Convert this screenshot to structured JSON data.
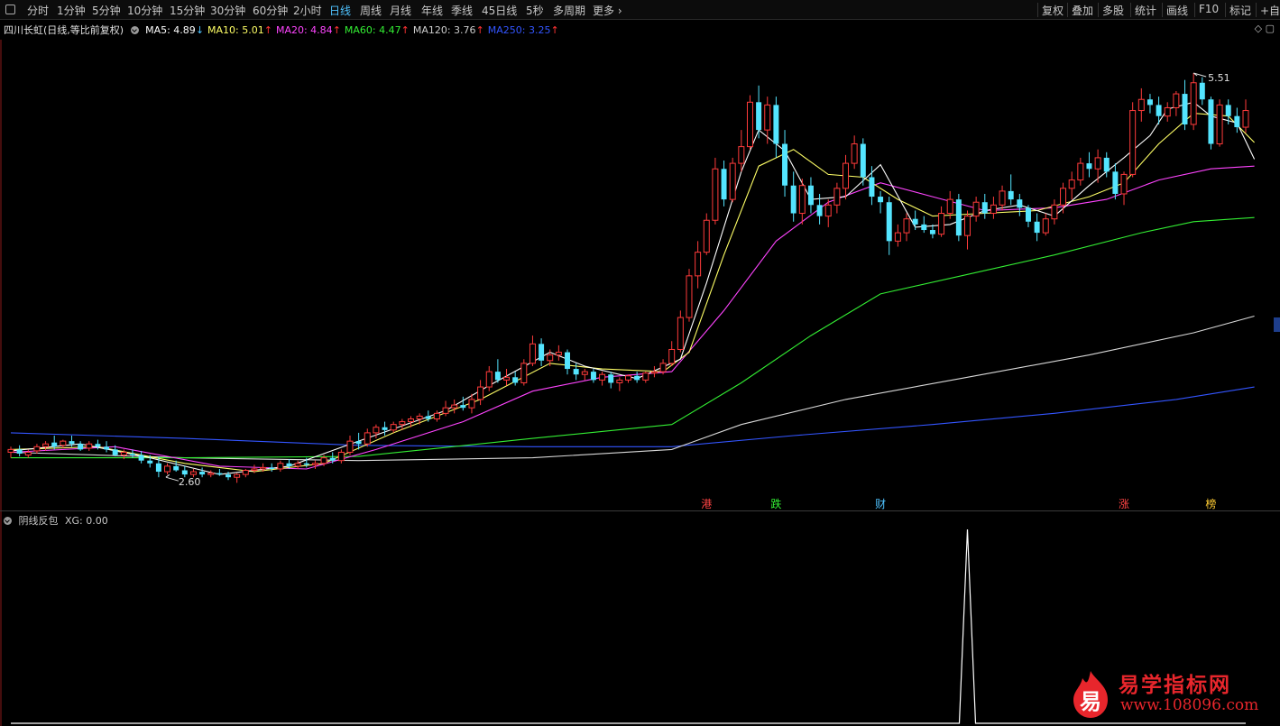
{
  "toolbar": {
    "tabs": [
      "分时",
      "1分钟",
      "5分钟",
      "10分钟",
      "15分钟",
      "30分钟",
      "60分钟",
      "2小时",
      "日线",
      "周线",
      "月线",
      "年线",
      "季线",
      "45日线",
      "5秒",
      "多周期",
      "更多"
    ],
    "active_tab": "日线",
    "right_buttons": [
      "复权",
      "叠加",
      "多股",
      "统计",
      "画线",
      "F10",
      "标记",
      "+自选"
    ]
  },
  "legend": {
    "title": "四川长虹(日线,等比前复权)",
    "ma": [
      {
        "label": "MA5: 4.89",
        "arrow": "↓",
        "color": "#ffffff",
        "arrow_color": "#4fc3ff"
      },
      {
        "label": "MA10: 5.01",
        "arrow": "↑",
        "color": "#ffff66",
        "arrow_color": "#ff3333"
      },
      {
        "label": "MA20: 4.84",
        "arrow": "↑",
        "color": "#ff44ff",
        "arrow_color": "#ff3333"
      },
      {
        "label": "MA60: 4.47",
        "arrow": "↑",
        "color": "#33ee33",
        "arrow_color": "#ff3333"
      },
      {
        "label": "MA120: 3.76",
        "arrow": "↑",
        "color": "#cccccc",
        "arrow_color": "#ff3333"
      },
      {
        "label": "MA250: 3.25",
        "arrow": "↑",
        "color": "#3355ff",
        "arrow_color": "#ff3333"
      }
    ]
  },
  "indicator": {
    "name": "阴线反包",
    "value_label": "XG: 0.00"
  },
  "chart_data": {
    "type": "candlestick",
    "price_range": [
      2.4,
      5.75
    ],
    "high_label": "5.51",
    "low_label": "2.60",
    "colors": {
      "up": "#ff3b3b",
      "down": "#54e5ff",
      "ma5": "#ffffff",
      "ma10": "#ffff66",
      "ma20": "#ff44ff",
      "ma60": "#33ee33",
      "ma120": "#d8d8d8",
      "ma250": "#3355ff"
    },
    "markers": [
      {
        "text": "港",
        "index": 80,
        "color": "#ff4444"
      },
      {
        "text": "跌",
        "index": 88,
        "color": "#33ee33"
      },
      {
        "text": "财",
        "index": 100,
        "color": "#4fc3ff"
      },
      {
        "text": "涨",
        "index": 128,
        "color": "#ff4444"
      },
      {
        "text": "榜",
        "index": 138,
        "color": "#ffcc33"
      }
    ],
    "xg_signal_index": 110,
    "ohlc": [
      [
        2.78,
        2.82,
        2.74,
        2.8
      ],
      [
        2.8,
        2.83,
        2.75,
        2.77
      ],
      [
        2.76,
        2.8,
        2.74,
        2.78
      ],
      [
        2.79,
        2.84,
        2.77,
        2.82
      ],
      [
        2.82,
        2.86,
        2.79,
        2.84
      ],
      [
        2.85,
        2.9,
        2.8,
        2.82
      ],
      [
        2.83,
        2.87,
        2.81,
        2.86
      ],
      [
        2.86,
        2.9,
        2.82,
        2.84
      ],
      [
        2.84,
        2.86,
        2.79,
        2.8
      ],
      [
        2.81,
        2.86,
        2.79,
        2.84
      ],
      [
        2.84,
        2.87,
        2.8,
        2.82
      ],
      [
        2.82,
        2.86,
        2.78,
        2.8
      ],
      [
        2.8,
        2.83,
        2.75,
        2.76
      ],
      [
        2.76,
        2.8,
        2.73,
        2.78
      ],
      [
        2.77,
        2.8,
        2.74,
        2.76
      ],
      [
        2.76,
        2.79,
        2.7,
        2.72
      ],
      [
        2.72,
        2.76,
        2.67,
        2.7
      ],
      [
        2.7,
        2.75,
        2.6,
        2.64
      ],
      [
        2.64,
        2.7,
        2.62,
        2.68
      ],
      [
        2.68,
        2.72,
        2.64,
        2.65
      ],
      [
        2.65,
        2.68,
        2.6,
        2.62
      ],
      [
        2.62,
        2.66,
        2.6,
        2.64
      ],
      [
        2.64,
        2.67,
        2.6,
        2.62
      ],
      [
        2.62,
        2.65,
        2.6,
        2.63
      ],
      [
        2.63,
        2.66,
        2.61,
        2.62
      ],
      [
        2.62,
        2.64,
        2.58,
        2.6
      ],
      [
        2.6,
        2.63,
        2.56,
        2.62
      ],
      [
        2.62,
        2.66,
        2.6,
        2.65
      ],
      [
        2.65,
        2.69,
        2.63,
        2.66
      ],
      [
        2.66,
        2.7,
        2.64,
        2.67
      ],
      [
        2.67,
        2.7,
        2.64,
        2.66
      ],
      [
        2.66,
        2.72,
        2.64,
        2.7
      ],
      [
        2.7,
        2.73,
        2.66,
        2.68
      ],
      [
        2.68,
        2.72,
        2.66,
        2.7
      ],
      [
        2.7,
        2.74,
        2.67,
        2.69
      ],
      [
        2.69,
        2.72,
        2.66,
        2.7
      ],
      [
        2.7,
        2.76,
        2.68,
        2.74
      ],
      [
        2.74,
        2.78,
        2.7,
        2.72
      ],
      [
        2.72,
        2.8,
        2.7,
        2.78
      ],
      [
        2.78,
        2.9,
        2.76,
        2.86
      ],
      [
        2.86,
        2.92,
        2.8,
        2.84
      ],
      [
        2.84,
        2.95,
        2.82,
        2.92
      ],
      [
        2.92,
        2.98,
        2.88,
        2.96
      ],
      [
        2.96,
        3.0,
        2.9,
        2.94
      ],
      [
        2.94,
        3.0,
        2.92,
        2.98
      ],
      [
        2.98,
        3.02,
        2.94,
        3.0
      ],
      [
        3.0,
        3.04,
        2.96,
        3.02
      ],
      [
        3.02,
        3.06,
        2.98,
        3.04
      ],
      [
        3.04,
        3.08,
        3.0,
        3.02
      ],
      [
        3.02,
        3.08,
        3.0,
        3.06
      ],
      [
        3.06,
        3.15,
        3.04,
        3.1
      ],
      [
        3.1,
        3.16,
        3.06,
        3.12
      ],
      [
        3.12,
        3.18,
        3.08,
        3.1
      ],
      [
        3.1,
        3.2,
        3.06,
        3.16
      ],
      [
        3.16,
        3.3,
        3.12,
        3.25
      ],
      [
        3.25,
        3.4,
        3.22,
        3.36
      ],
      [
        3.36,
        3.45,
        3.28,
        3.3
      ],
      [
        3.3,
        3.38,
        3.26,
        3.32
      ],
      [
        3.32,
        3.36,
        3.26,
        3.28
      ],
      [
        3.28,
        3.45,
        3.26,
        3.42
      ],
      [
        3.42,
        3.62,
        3.4,
        3.56
      ],
      [
        3.56,
        3.6,
        3.4,
        3.44
      ],
      [
        3.44,
        3.52,
        3.4,
        3.48
      ],
      [
        3.48,
        3.55,
        3.44,
        3.5
      ],
      [
        3.5,
        3.52,
        3.34,
        3.38
      ],
      [
        3.38,
        3.42,
        3.3,
        3.34
      ],
      [
        3.34,
        3.38,
        3.3,
        3.36
      ],
      [
        3.36,
        3.38,
        3.28,
        3.3
      ],
      [
        3.3,
        3.36,
        3.26,
        3.34
      ],
      [
        3.34,
        3.36,
        3.24,
        3.28
      ],
      [
        3.28,
        3.32,
        3.22,
        3.3
      ],
      [
        3.3,
        3.34,
        3.28,
        3.33
      ],
      [
        3.33,
        3.36,
        3.28,
        3.3
      ],
      [
        3.3,
        3.36,
        3.28,
        3.35
      ],
      [
        3.35,
        3.4,
        3.32,
        3.36
      ],
      [
        3.36,
        3.45,
        3.34,
        3.42
      ],
      [
        3.42,
        3.58,
        3.4,
        3.52
      ],
      [
        3.52,
        3.8,
        3.5,
        3.75
      ],
      [
        3.75,
        4.1,
        3.72,
        4.05
      ],
      [
        4.05,
        4.3,
        3.96,
        4.22
      ],
      [
        4.22,
        4.5,
        4.2,
        4.45
      ],
      [
        4.45,
        4.9,
        4.42,
        4.82
      ],
      [
        4.82,
        4.88,
        4.55,
        4.6
      ],
      [
        4.6,
        4.9,
        4.58,
        4.86
      ],
      [
        4.86,
        5.1,
        4.8,
        4.98
      ],
      [
        4.98,
        5.35,
        4.96,
        5.3
      ],
      [
        5.3,
        5.42,
        5.04,
        5.1
      ],
      [
        5.1,
        5.34,
        5.0,
        5.28
      ],
      [
        5.28,
        5.34,
        4.9,
        5.0
      ],
      [
        5.0,
        5.1,
        4.62,
        4.7
      ],
      [
        4.7,
        4.8,
        4.44,
        4.5
      ],
      [
        4.5,
        4.75,
        4.42,
        4.7
      ],
      [
        4.7,
        4.76,
        4.5,
        4.56
      ],
      [
        4.56,
        4.64,
        4.42,
        4.48
      ],
      [
        4.48,
        4.6,
        4.4,
        4.56
      ],
      [
        4.56,
        4.72,
        4.5,
        4.68
      ],
      [
        4.68,
        4.92,
        4.6,
        4.86
      ],
      [
        4.86,
        5.06,
        4.82,
        5.0
      ],
      [
        5.0,
        5.04,
        4.7,
        4.76
      ],
      [
        4.76,
        4.84,
        4.56,
        4.62
      ],
      [
        4.62,
        4.66,
        4.5,
        4.58
      ],
      [
        4.58,
        4.62,
        4.2,
        4.3
      ],
      [
        4.3,
        4.42,
        4.26,
        4.36
      ],
      [
        4.36,
        4.5,
        4.3,
        4.46
      ],
      [
        4.46,
        4.52,
        4.38,
        4.42
      ],
      [
        4.42,
        4.48,
        4.36,
        4.38
      ],
      [
        4.38,
        4.42,
        4.32,
        4.35
      ],
      [
        4.35,
        4.55,
        4.33,
        4.5
      ],
      [
        4.5,
        4.66,
        4.46,
        4.6
      ],
      [
        4.6,
        4.64,
        4.3,
        4.34
      ],
      [
        4.34,
        4.52,
        4.24,
        4.48
      ],
      [
        4.48,
        4.62,
        4.44,
        4.58
      ],
      [
        4.58,
        4.64,
        4.46,
        4.5
      ],
      [
        4.5,
        4.62,
        4.46,
        4.56
      ],
      [
        4.56,
        4.7,
        4.52,
        4.66
      ],
      [
        4.66,
        4.78,
        4.56,
        4.6
      ],
      [
        4.6,
        4.64,
        4.48,
        4.54
      ],
      [
        4.54,
        4.56,
        4.4,
        4.44
      ],
      [
        4.44,
        4.5,
        4.3,
        4.36
      ],
      [
        4.36,
        4.5,
        4.34,
        4.46
      ],
      [
        4.46,
        4.6,
        4.42,
        4.56
      ],
      [
        4.56,
        4.72,
        4.5,
        4.68
      ],
      [
        4.68,
        4.8,
        4.6,
        4.74
      ],
      [
        4.74,
        4.9,
        4.7,
        4.86
      ],
      [
        4.86,
        4.94,
        4.76,
        4.82
      ],
      [
        4.82,
        4.96,
        4.72,
        4.9
      ],
      [
        4.9,
        4.94,
        4.76,
        4.8
      ],
      [
        4.8,
        4.86,
        4.6,
        4.64
      ],
      [
        4.64,
        4.8,
        4.56,
        4.78
      ],
      [
        4.78,
        5.3,
        4.76,
        5.24
      ],
      [
        5.24,
        5.4,
        5.16,
        5.32
      ],
      [
        5.32,
        5.36,
        5.22,
        5.28
      ],
      [
        5.28,
        5.34,
        5.14,
        5.2
      ],
      [
        5.2,
        5.3,
        5.16,
        5.26
      ],
      [
        5.26,
        5.38,
        5.2,
        5.36
      ],
      [
        5.36,
        5.46,
        5.1,
        5.14
      ],
      [
        5.14,
        5.51,
        5.1,
        5.44
      ],
      [
        5.44,
        5.48,
        5.28,
        5.32
      ],
      [
        5.32,
        5.34,
        4.96,
        5.0
      ],
      [
        5.0,
        5.32,
        4.98,
        5.28
      ],
      [
        5.28,
        5.32,
        5.14,
        5.2
      ],
      [
        5.2,
        5.26,
        5.08,
        5.12
      ],
      [
        5.12,
        5.32,
        5.08,
        5.24
      ]
    ],
    "ma": {
      "ma5": [
        [
          0,
          2.79
        ],
        [
          8,
          2.84
        ],
        [
          16,
          2.74
        ],
        [
          24,
          2.62
        ],
        [
          32,
          2.68
        ],
        [
          40,
          2.86
        ],
        [
          50,
          3.08
        ],
        [
          55,
          3.26
        ],
        [
          62,
          3.5
        ],
        [
          66,
          3.4
        ],
        [
          72,
          3.31
        ],
        [
          77,
          3.45
        ],
        [
          80,
          4.0
        ],
        [
          84,
          4.8
        ],
        [
          86,
          5.1
        ],
        [
          89,
          4.95
        ],
        [
          92,
          4.6
        ],
        [
          96,
          4.62
        ],
        [
          100,
          4.85
        ],
        [
          104,
          4.4
        ],
        [
          108,
          4.42
        ],
        [
          112,
          4.52
        ],
        [
          116,
          4.56
        ],
        [
          120,
          4.48
        ],
        [
          124,
          4.7
        ],
        [
          128,
          4.9
        ],
        [
          131,
          5.06
        ],
        [
          133,
          5.25
        ],
        [
          136,
          5.3
        ],
        [
          138,
          5.2
        ],
        [
          141,
          5.15
        ],
        [
          143,
          4.89
        ]
      ],
      "ma10": [
        [
          0,
          2.8
        ],
        [
          10,
          2.82
        ],
        [
          20,
          2.7
        ],
        [
          28,
          2.64
        ],
        [
          36,
          2.7
        ],
        [
          44,
          2.92
        ],
        [
          54,
          3.16
        ],
        [
          62,
          3.42
        ],
        [
          68,
          3.38
        ],
        [
          75,
          3.36
        ],
        [
          78,
          3.5
        ],
        [
          82,
          4.2
        ],
        [
          86,
          4.84
        ],
        [
          90,
          4.96
        ],
        [
          94,
          4.78
        ],
        [
          98,
          4.76
        ],
        [
          102,
          4.6
        ],
        [
          106,
          4.48
        ],
        [
          112,
          4.5
        ],
        [
          118,
          4.52
        ],
        [
          124,
          4.62
        ],
        [
          128,
          4.72
        ],
        [
          132,
          5.0
        ],
        [
          136,
          5.22
        ],
        [
          140,
          5.2
        ],
        [
          143,
          5.01
        ]
      ],
      "ma20": [
        [
          0,
          2.78
        ],
        [
          12,
          2.82
        ],
        [
          24,
          2.68
        ],
        [
          34,
          2.66
        ],
        [
          42,
          2.8
        ],
        [
          52,
          3.0
        ],
        [
          60,
          3.22
        ],
        [
          68,
          3.32
        ],
        [
          76,
          3.36
        ],
        [
          82,
          3.8
        ],
        [
          88,
          4.3
        ],
        [
          94,
          4.58
        ],
        [
          100,
          4.72
        ],
        [
          106,
          4.62
        ],
        [
          112,
          4.52
        ],
        [
          120,
          4.54
        ],
        [
          126,
          4.6
        ],
        [
          132,
          4.74
        ],
        [
          138,
          4.82
        ],
        [
          143,
          4.84
        ]
      ],
      "ma60": [
        [
          0,
          2.74
        ],
        [
          20,
          2.74
        ],
        [
          40,
          2.75
        ],
        [
          60,
          2.88
        ],
        [
          76,
          2.98
        ],
        [
          84,
          3.28
        ],
        [
          92,
          3.62
        ],
        [
          100,
          3.92
        ],
        [
          110,
          4.06
        ],
        [
          120,
          4.2
        ],
        [
          130,
          4.36
        ],
        [
          136,
          4.44
        ],
        [
          143,
          4.47
        ]
      ],
      "ma120": [
        [
          0,
          2.78
        ],
        [
          20,
          2.74
        ],
        [
          40,
          2.72
        ],
        [
          60,
          2.74
        ],
        [
          76,
          2.8
        ],
        [
          84,
          2.98
        ],
        [
          96,
          3.16
        ],
        [
          110,
          3.32
        ],
        [
          124,
          3.48
        ],
        [
          136,
          3.64
        ],
        [
          143,
          3.76
        ]
      ],
      "ma250": [
        [
          0,
          2.92
        ],
        [
          20,
          2.88
        ],
        [
          40,
          2.83
        ],
        [
          60,
          2.82
        ],
        [
          76,
          2.82
        ],
        [
          90,
          2.9
        ],
        [
          106,
          2.98
        ],
        [
          120,
          3.06
        ],
        [
          134,
          3.16
        ],
        [
          143,
          3.25
        ]
      ]
    },
    "xg_range": [
      0,
      1
    ]
  },
  "watermark": {
    "logo_char": "易",
    "title": "易学指标网",
    "url": "www.108096.com"
  }
}
